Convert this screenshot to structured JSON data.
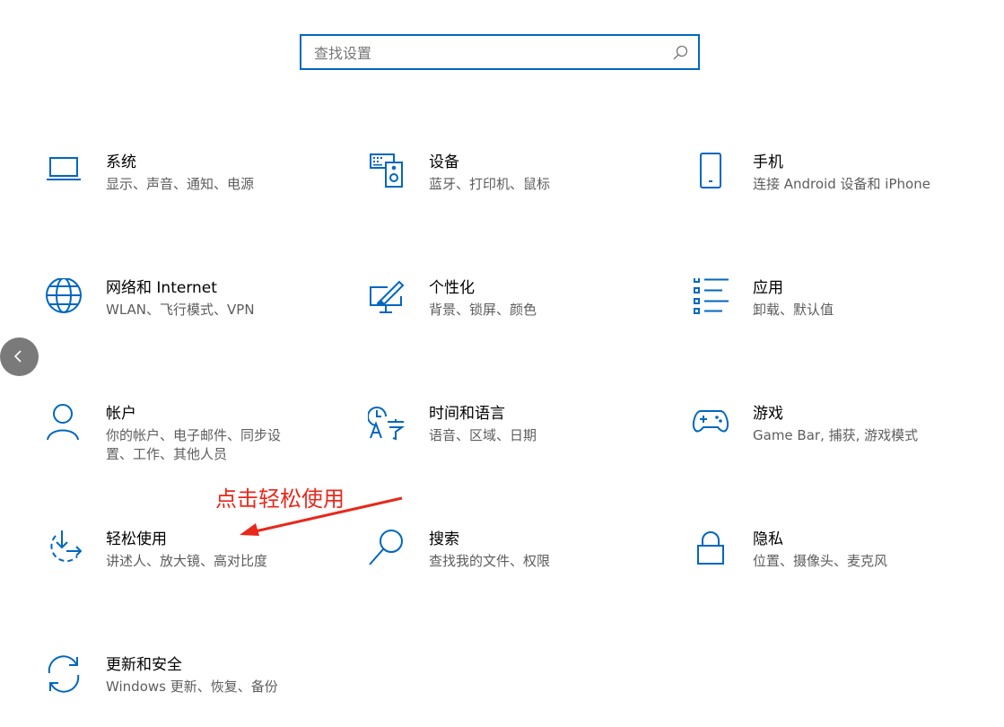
{
  "search": {
    "placeholder": "查找设置",
    "icon": "search-icon"
  },
  "colors": {
    "accent": "#0067c0",
    "annotation": "#e8281c",
    "back_button": "#7a7a7a"
  },
  "tiles": [
    {
      "id": "system",
      "title": "系统",
      "desc": "显示、声音、通知、电源",
      "icon": "laptop-icon"
    },
    {
      "id": "devices",
      "title": "设备",
      "desc": "蓝牙、打印机、鼠标",
      "icon": "keyboard-speaker-icon"
    },
    {
      "id": "phone",
      "title": "手机",
      "desc": "连接 Android 设备和 iPhone",
      "icon": "phone-icon"
    },
    {
      "id": "network",
      "title": "网络和 Internet",
      "desc": "WLAN、飞行模式、VPN",
      "icon": "globe-icon"
    },
    {
      "id": "personalization",
      "title": "个性化",
      "desc": "背景、锁屏、颜色",
      "icon": "paint-monitor-icon"
    },
    {
      "id": "apps",
      "title": "应用",
      "desc": "卸载、默认值",
      "icon": "app-list-icon"
    },
    {
      "id": "accounts",
      "title": "帐户",
      "desc": "你的帐户、电子邮件、同步设置、工作、其他人员",
      "icon": "person-icon"
    },
    {
      "id": "time-language",
      "title": "时间和语言",
      "desc": "语音、区域、日期",
      "icon": "time-language-icon"
    },
    {
      "id": "gaming",
      "title": "游戏",
      "desc": "Game Bar, 捕获, 游戏模式",
      "icon": "gamepad-icon"
    },
    {
      "id": "ease-of-access",
      "title": "轻松使用",
      "desc": "讲述人、放大镜、高对比度",
      "icon": "ease-of-access-icon"
    },
    {
      "id": "search",
      "title": "搜索",
      "desc": "查找我的文件、权限",
      "icon": "magnifier-icon"
    },
    {
      "id": "privacy",
      "title": "隐私",
      "desc": "位置、摄像头、麦克风",
      "icon": "lock-icon"
    },
    {
      "id": "update-security",
      "title": "更新和安全",
      "desc": "Windows 更新、恢复、备份",
      "icon": "sync-arrows-icon"
    }
  ],
  "annotation": {
    "text": "点击轻松使用"
  },
  "back_button": {
    "icon": "chevron-left-icon"
  }
}
